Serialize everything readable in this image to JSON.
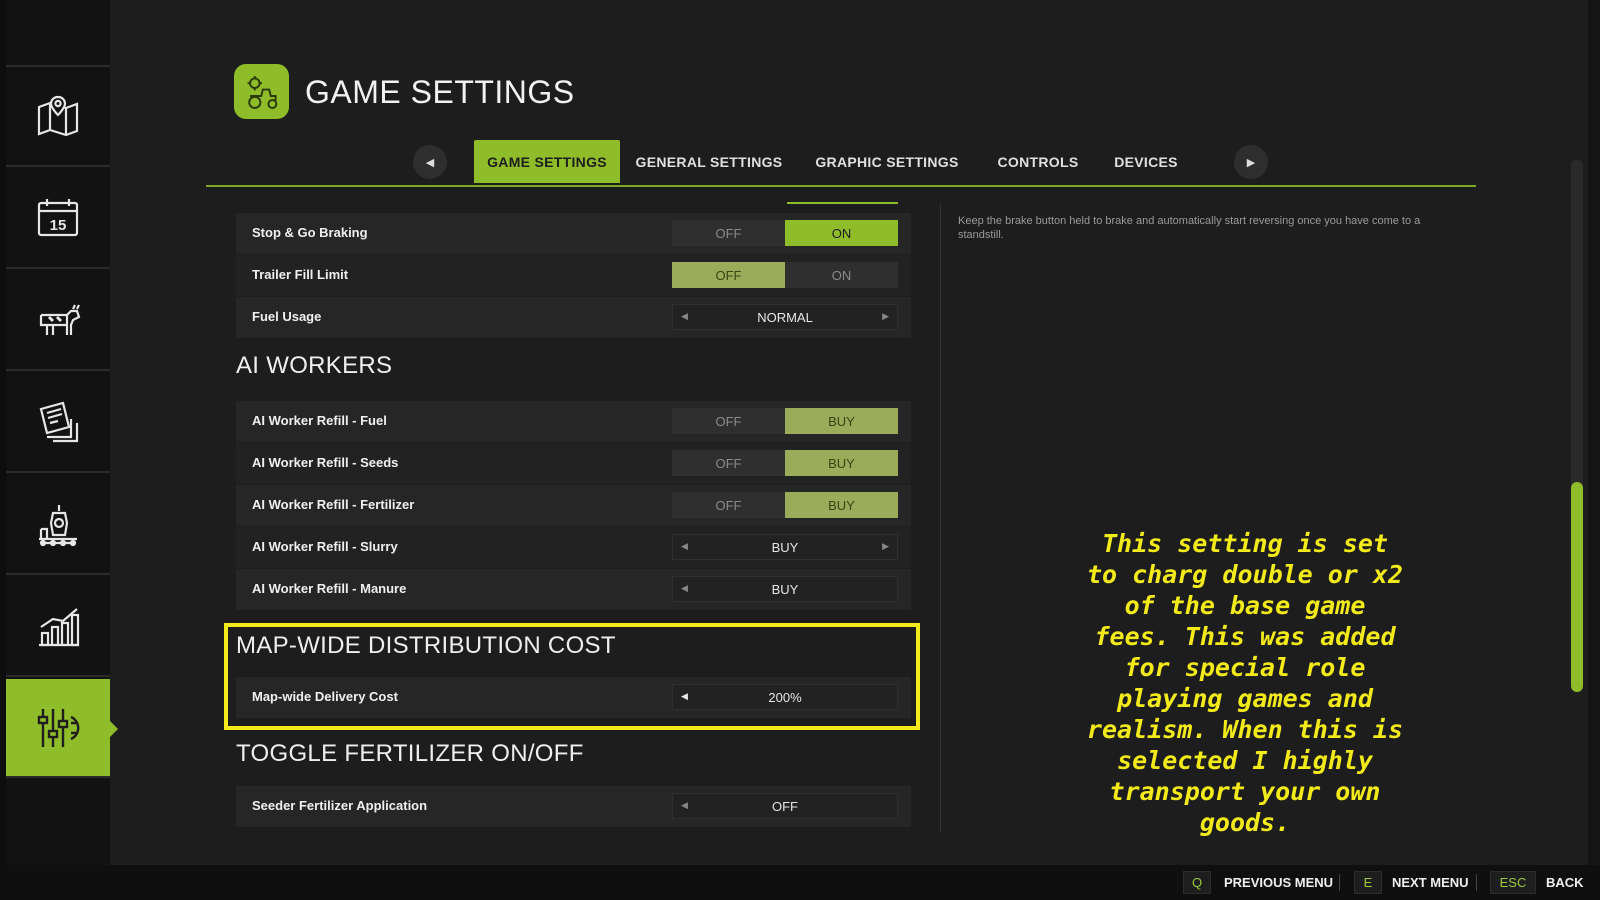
{
  "header": {
    "title": "GAME SETTINGS",
    "icon": "tractor-gear-icon"
  },
  "sidebar": {
    "items": [
      {
        "icon": "map-icon"
      },
      {
        "icon": "calendar-icon",
        "day": "15"
      },
      {
        "icon": "livestock-icon"
      },
      {
        "icon": "contracts-icon"
      },
      {
        "icon": "production-icon"
      },
      {
        "icon": "statistics-icon"
      },
      {
        "icon": "settings-sliders-icon",
        "active": true
      }
    ]
  },
  "tabs": [
    {
      "label": "GAME SETTINGS",
      "active": true
    },
    {
      "label": "GENERAL SETTINGS"
    },
    {
      "label": "GRAPHIC SETTINGS"
    },
    {
      "label": "CONTROLS"
    },
    {
      "label": "DEVICES"
    }
  ],
  "settings": {
    "stop_go": {
      "label": "Stop & Go Braking",
      "off": "OFF",
      "on": "ON",
      "selected": "ON"
    },
    "trailer_fill": {
      "label": "Trailer Fill Limit",
      "off": "OFF",
      "on": "ON",
      "selected": "OFF"
    },
    "fuel_usage": {
      "label": "Fuel Usage",
      "value": "NORMAL"
    },
    "ai_section": "AI WORKERS",
    "ai_fuel": {
      "label": "AI Worker Refill - Fuel",
      "off": "OFF",
      "on": "BUY",
      "selected": "BUY"
    },
    "ai_seeds": {
      "label": "AI Worker Refill - Seeds",
      "off": "OFF",
      "on": "BUY",
      "selected": "BUY"
    },
    "ai_fert": {
      "label": "AI Worker Refill - Fertilizer",
      "off": "OFF",
      "on": "BUY",
      "selected": "BUY"
    },
    "ai_slurry": {
      "label": "AI Worker Refill - Slurry",
      "value": "BUY"
    },
    "ai_manure": {
      "label": "AI Worker Refill - Manure",
      "value": "BUY"
    },
    "map_section": "MAP-WIDE DISTRIBUTION COST",
    "map_delivery": {
      "label": "Map-wide Delivery Cost",
      "value": "200%"
    },
    "fert_section": "TOGGLE FERTILIZER ON/OFF",
    "seeder_fert": {
      "label": "Seeder Fertilizer Application",
      "value": "OFF"
    }
  },
  "description": "Keep the brake button held to brake and automatically start reversing once you have come to a standstill.",
  "annotation": "This setting is set to charg double or x2 of the base game fees. This was added for special role playing games and realism.  When this is selected I highly transport your own goods.",
  "footer": [
    {
      "key": "Q",
      "label": "PREVIOUS MENU"
    },
    {
      "key": "E",
      "label": "NEXT MENU"
    },
    {
      "key": "ESC",
      "label": "BACK"
    }
  ],
  "colors": {
    "accent": "#8fbd2a",
    "highlight": "#f3ea1a",
    "background": "#1d1d1d"
  }
}
